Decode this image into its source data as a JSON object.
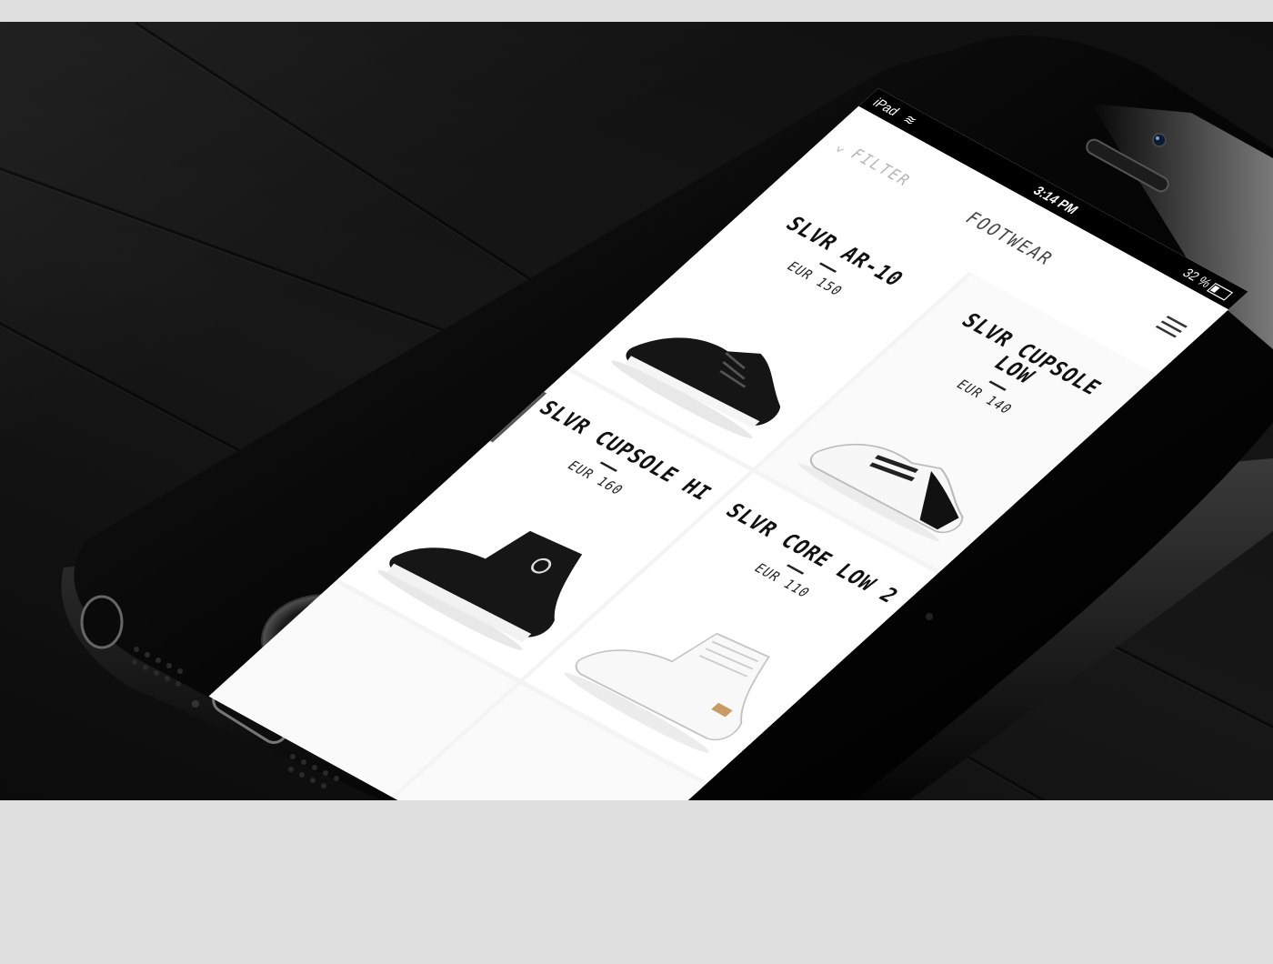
{
  "status_bar": {
    "carrier": "iPad",
    "time": "3:14 PM",
    "battery": "32 %"
  },
  "nav": {
    "filter_label": "FILTER",
    "title": "FOOTWEAR"
  },
  "products": [
    {
      "name": "SLVR AR-10",
      "price": "EUR 150",
      "shoe_color": "black"
    },
    {
      "name": "SLVR CUPSOLE LOW",
      "price": "EUR 140",
      "shoe_color": "white"
    },
    {
      "name": "SLVR CUPSOLE HI",
      "price": "EUR 160",
      "shoe_color": "black"
    },
    {
      "name": "SLVR CORE LOW 2",
      "price": "EUR 110",
      "shoe_color": "white"
    }
  ],
  "icons": {
    "filter": "chevron-down-icon",
    "menu": "hamburger-menu-icon",
    "wifi": "wifi-icon",
    "battery": "battery-icon",
    "home": "home-button-icon"
  },
  "colors": {
    "background_table": "#131313",
    "page_bg": "#dfdfdf",
    "phone_body": "#050505",
    "screen_bg": "#ffffff"
  }
}
